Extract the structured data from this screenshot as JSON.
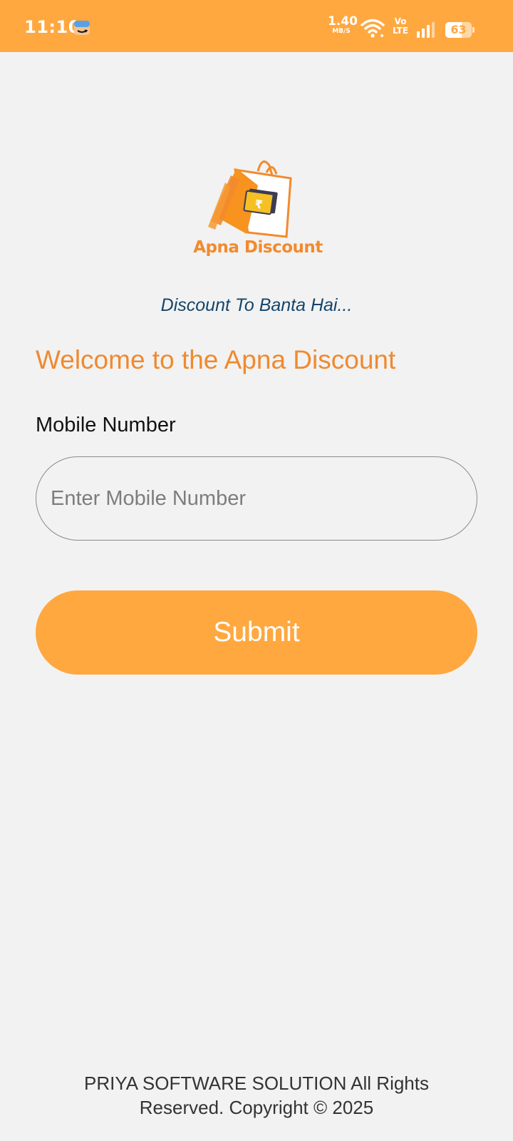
{
  "status_bar": {
    "time": "11:10",
    "notification_icon": "amazon-icon",
    "network_speed_value": "1.40",
    "network_speed_unit": "MB/S",
    "volte_top": "Vo",
    "volte_bottom": "LTE",
    "battery_level": "63",
    "icons": [
      "wifi-icon",
      "signal-icon",
      "battery-icon"
    ],
    "color": "#ffa83f"
  },
  "brand": {
    "logo_text": "Apna Discount",
    "tagline": "Discount To Banta Hai...",
    "primary_color": "#ffa83f",
    "accent_color": "#ef8a2f",
    "tagline_color": "#15456b"
  },
  "form": {
    "welcome_title": "Welcome to the Apna Discount",
    "mobile_label": "Mobile Number",
    "mobile_value": "",
    "mobile_placeholder": "Enter Mobile Number",
    "submit_label": "Submit"
  },
  "footer": {
    "line1": "PRIYA SOFTWARE SOLUTION All Rights",
    "line2": "Reserved. Copyright © 2025"
  }
}
